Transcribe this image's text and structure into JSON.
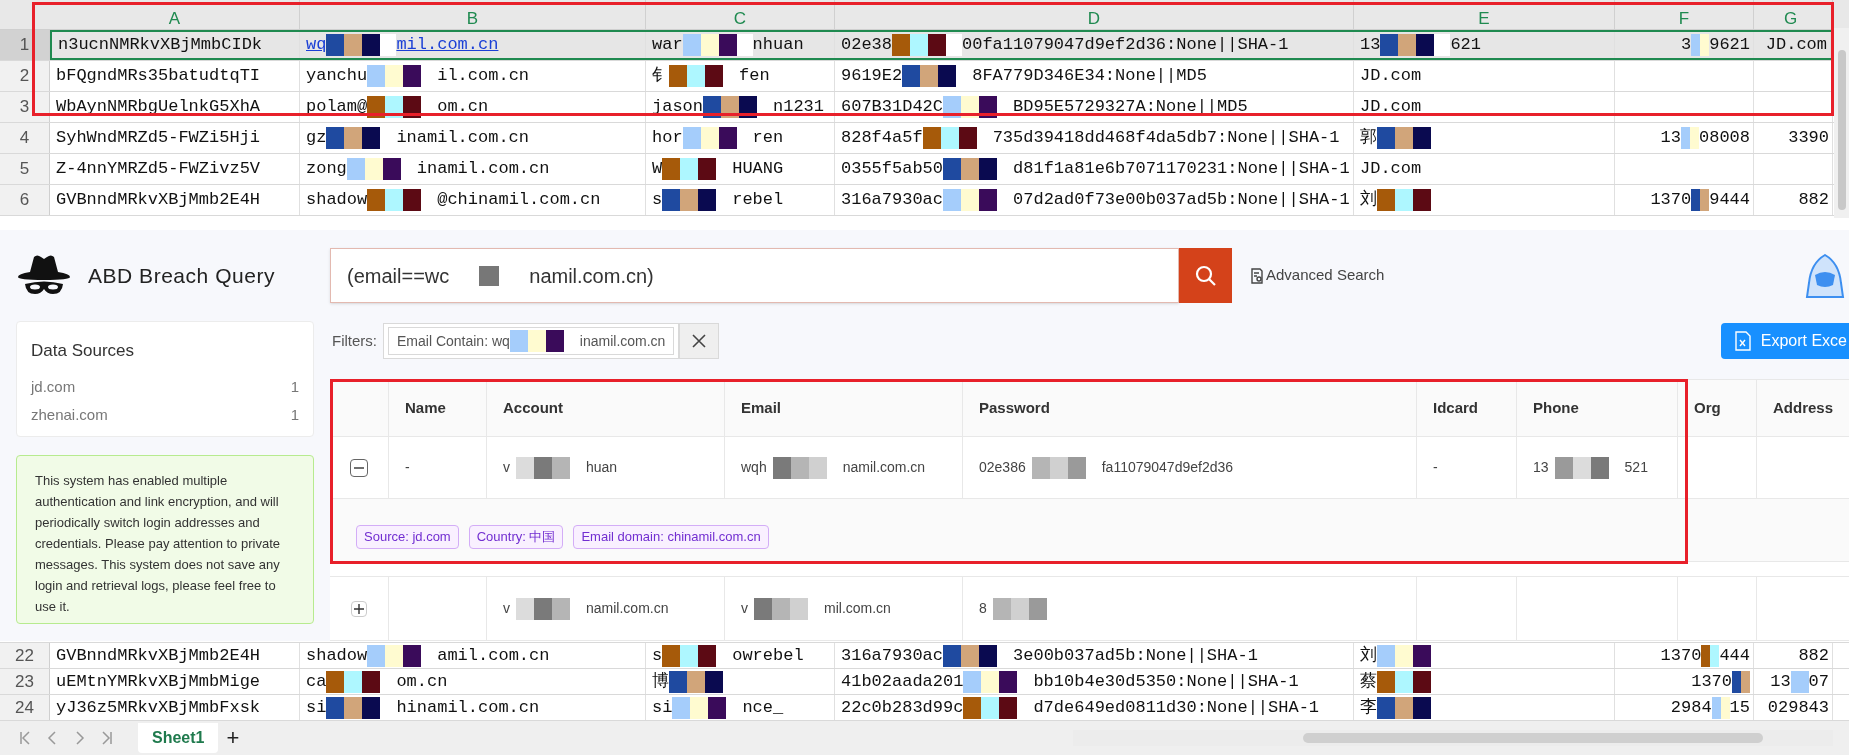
{
  "spreadsheet": {
    "columns": [
      "A",
      "B",
      "C",
      "D",
      "E",
      "F",
      "G"
    ],
    "top_rows": [
      {
        "number": "1",
        "selected": true,
        "cells": [
          [
            "n3ucnNMRkvXBjMmbCIDk"
          ],
          {
            "kind": "link",
            "t": [
              "wq",
              "mil.com.cn"
            ]
          },
          [
            "war",
            "nhuan"
          ],
          [
            "02e38",
            "00fa11079047d9ef2d36:None||SHA-1"
          ],
          [
            "13",
            "621"
          ],
          [
            "3",
            "9621"
          ],
          [
            "JD.com"
          ]
        ]
      },
      {
        "number": "2",
        "selected": false,
        "cells": [
          [
            "bFQgndMRs35batudtqTI"
          ],
          [
            "yanchu",
            "il.com.cn"
          ],
          [
            "钅",
            "fen"
          ],
          [
            "9619E2",
            "8FA779D346E34:None||MD5"
          ],
          [
            "JD.com"
          ],
          [],
          []
        ]
      },
      {
        "number": "3",
        "selected": false,
        "cells": [
          [
            "WbAynNMRbgUelnkG5XhA"
          ],
          [
            "polam@",
            "om.cn"
          ],
          [
            "jason",
            "n1231"
          ],
          [
            "607B31D42C",
            "BD95E5729327A:None||MD5"
          ],
          [
            "JD.com"
          ],
          [],
          []
        ]
      },
      {
        "number": "4",
        "selected": false,
        "cells": [
          [
            "SyhWndMRZd5-FWZi5Hji"
          ],
          [
            "gz",
            "inamil.com.cn"
          ],
          [
            "hor",
            "ren"
          ],
          [
            "828f4a5f",
            "735d39418dd468f4da5db7:None||SHA-1"
          ],
          [
            "郭",
            ""
          ],
          [
            "13",
            "08008"
          ],
          [
            "3390"
          ]
        ]
      },
      {
        "number": "5",
        "selected": false,
        "cells": [
          [
            "Z-4nnYMRZd5-FWZivz5V"
          ],
          [
            "zong",
            "inamil.com.cn"
          ],
          [
            "W",
            "HUANG"
          ],
          [
            "0355f5ab50",
            "d81f1a81e6b7071170231:None||SHA-1"
          ],
          [
            "JD.com"
          ],
          [],
          []
        ]
      },
      {
        "number": "6",
        "selected": false,
        "cells": [
          [
            "GVBnndMRkvXBjMmb2E4H"
          ],
          [
            "shadow",
            "@chinamil.com.cn"
          ],
          [
            "s",
            "rebel"
          ],
          [
            "316a7930ac",
            "07d2ad0f73e00b037ad5b:None||SHA-1"
          ],
          [
            "刘",
            ""
          ],
          [
            "1370",
            "9444"
          ],
          [
            "882"
          ]
        ]
      }
    ],
    "bottom_rows": [
      {
        "number": "22",
        "selected": false,
        "cells": [
          [
            "GVBnndMRkvXBjMmb2E4H"
          ],
          [
            "shadow",
            "amil.com.cn"
          ],
          [
            "s",
            "owrebel"
          ],
          [
            "316a7930ac",
            "3e00b037ad5b:None||SHA-1"
          ],
          [
            "刘",
            ""
          ],
          [
            "1370",
            "444"
          ],
          [
            "882"
          ]
        ]
      },
      {
        "number": "23",
        "selected": false,
        "cells": [
          [
            "uEMtnYMRkvXBjMmbMige"
          ],
          [
            "ca",
            "om.cn"
          ],
          [
            "博",
            ""
          ],
          [
            "41b02aada201",
            "bb10b4e30d5350:None||SHA-1"
          ],
          [
            "蔡",
            ""
          ],
          [
            "1370",
            ""
          ],
          [
            "13",
            "07"
          ]
        ]
      },
      {
        "number": "24",
        "selected": false,
        "cells": [
          [
            "yJ36z5MRkvXBjMmbFxsk"
          ],
          [
            "si",
            "hinamil.com.cn"
          ],
          [
            "si",
            "nce_"
          ],
          [
            "22c0b283d99c",
            "d7de649ed0811d30:None||SHA-1"
          ],
          [
            "李",
            ""
          ],
          [
            "2984",
            "15"
          ],
          [
            "029843"
          ]
        ]
      }
    ],
    "sheet_tabs": [
      {
        "label": "Sheet1",
        "selected": true
      }
    ],
    "add_sheet": "+"
  },
  "app": {
    "title": "ABD Breach Query",
    "query": [
      "(email==wc",
      "namil.com.cn)"
    ],
    "advanced_search": "Advanced Search",
    "data_sources": {
      "title": "Data Sources",
      "items": [
        {
          "name": "jd.com",
          "count": "1"
        },
        {
          "name": "zhenai.com",
          "count": "1"
        }
      ]
    },
    "notice": "This system has enabled multiple authentication and link encryption, and will periodically switch login addresses and credentials. Please pay attention to private messages. This system does not save any login and retrieval logs, please feel free to use it.",
    "filters_label": "Filters:",
    "filters": [
      {
        "text": [
          "Email Contain: wq",
          "inamil.com.cn"
        ]
      }
    ],
    "export_button": "Export Exce",
    "table": {
      "columns": [
        "Name",
        "Account",
        "Email",
        "Password",
        "Idcard",
        "Phone",
        "Org",
        "Address"
      ],
      "rows": [
        {
          "expanded": true,
          "cells": [
            [
              "-"
            ],
            [
              "v",
              "huan"
            ],
            [
              "wqh",
              "namil.com.cn"
            ],
            [
              "02e386",
              "fa11079047d9ef2d36"
            ],
            [
              "-"
            ],
            [
              "13",
              "521"
            ],
            [],
            []
          ],
          "tags": [
            "Source: jd.com",
            "Country: 中国",
            "Email domain: chinamil.com.cn"
          ]
        },
        {
          "expanded": false,
          "cells": [
            [],
            [
              "v",
              "namil.com.cn"
            ],
            [
              "v",
              "mil.com.cn"
            ],
            [
              "8",
              ""
            ],
            [],
            [],
            [],
            []
          ]
        }
      ]
    }
  }
}
